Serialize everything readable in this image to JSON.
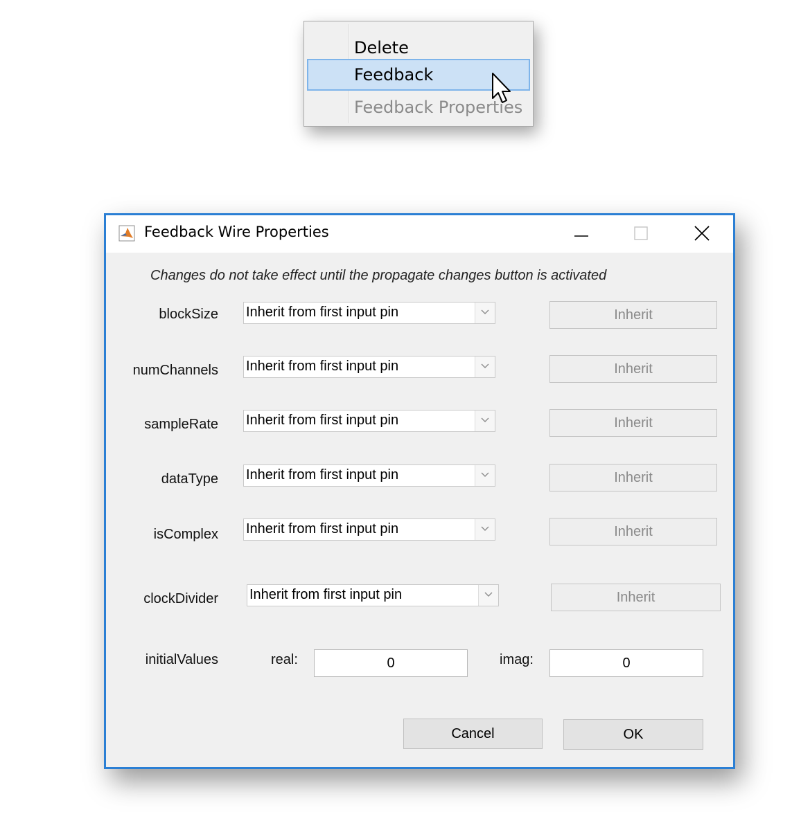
{
  "context_menu": {
    "items": [
      {
        "label": "Delete",
        "state": "normal"
      },
      {
        "label": "Feedback",
        "state": "highlighted"
      },
      {
        "label": "Feedback Properties",
        "state": "disabled"
      }
    ]
  },
  "dialog": {
    "title": "Feedback Wire Properties",
    "notice": "Changes do not take effect until the propagate changes button is activated",
    "rows": [
      {
        "label": "blockSize",
        "value": "Inherit from first input pin",
        "button": "Inherit"
      },
      {
        "label": "numChannels",
        "value": "Inherit from first input pin",
        "button": "Inherit"
      },
      {
        "label": "sampleRate",
        "value": "Inherit from first input pin",
        "button": "Inherit"
      },
      {
        "label": "dataType",
        "value": "Inherit from first input pin",
        "button": "Inherit"
      },
      {
        "label": "isComplex",
        "value": "Inherit from first input pin",
        "button": "Inherit"
      },
      {
        "label": "clockDivider",
        "value": "Inherit from first input pin",
        "button": "Inherit"
      }
    ],
    "initial_values": {
      "label": "initialValues",
      "real_label": "real:",
      "real_value": "0",
      "imag_label": "imag:",
      "imag_value": "0"
    },
    "cancel_label": "Cancel",
    "ok_label": "OK"
  },
  "colors": {
    "accent_border": "#2b7fd4",
    "menu_highlight": "#cce1f6",
    "disabled_text": "#8a8a8a"
  },
  "icons": [
    "matlab-app-icon",
    "minimize-icon",
    "maximize-icon",
    "close-icon",
    "chevron-down-icon",
    "mouse-pointer-icon"
  ]
}
